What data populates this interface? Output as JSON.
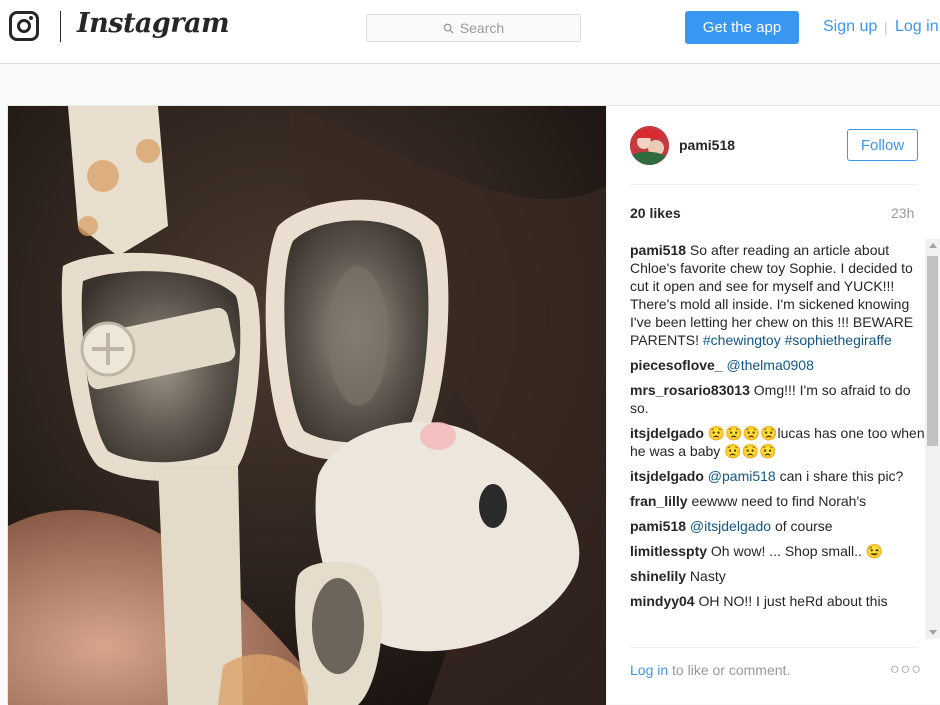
{
  "header": {
    "brand": "Instagram",
    "search_placeholder": "Search",
    "get_app": "Get the app",
    "sign_up": "Sign up",
    "separator": "|",
    "log_in": "Log in"
  },
  "post": {
    "username": "pami518",
    "follow_label": "Follow",
    "likes": "20 likes",
    "time": "23h",
    "comments": [
      {
        "user": "pami518",
        "text": " So after reading an article about Chloe's favorite chew toy Sophie. I decided to cut it open and see for myself and YUCK!!! There's mold all inside. I'm sickened knowing I've been letting her chew on this !!! BEWARE PARENTS! ",
        "tags": "#chewingtoy #sophiethegiraffe"
      },
      {
        "user": "piecesoflove_",
        "mention": " @thelma0908",
        "text": ""
      },
      {
        "user": "mrs_rosario83013",
        "text": " Omg!!! I'm so afraid to do so."
      },
      {
        "user": "itsjdelgado",
        "text": " 😟😟😟😟lucas has one too when he was a baby 😟😟😟"
      },
      {
        "user": "itsjdelgado",
        "mention": " @pami518",
        "text": " can i share this pic?"
      },
      {
        "user": "fran_lilly",
        "text": " eewww need to find Norah's"
      },
      {
        "user": "pami518",
        "mention": " @itsjdelgado",
        "text": " of course"
      },
      {
        "user": "limitlesspty",
        "text": " Oh wow! ... Shop small.. 😉"
      },
      {
        "user": "shinelily",
        "text": " Nasty"
      },
      {
        "user": "mindyy04",
        "text": " OH NO!! I just heRd about this"
      }
    ],
    "footer_login": "Log in",
    "footer_text": " to like or comment.",
    "more": "○○○"
  }
}
